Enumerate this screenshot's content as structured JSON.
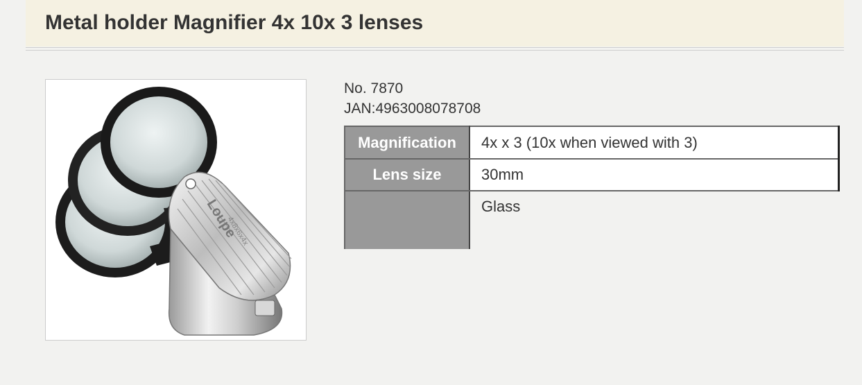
{
  "page": {
    "title": "Metal holder Magnifier 4x 10x 3 lenses"
  },
  "product": {
    "number": "No. 7870",
    "jan": "JAN:4963008078708",
    "image_icon": "magnifier-loupe-photo",
    "image_text": {
      "brand": "Loupe",
      "marking": "4x8x6x4x"
    }
  },
  "specs": [
    {
      "label": "Magnification",
      "value": "4x x 3 (10x when viewed with 3)"
    },
    {
      "label": "Lens size",
      "value": "30mm"
    },
    {
      "label": "",
      "value": "Glass"
    }
  ]
}
